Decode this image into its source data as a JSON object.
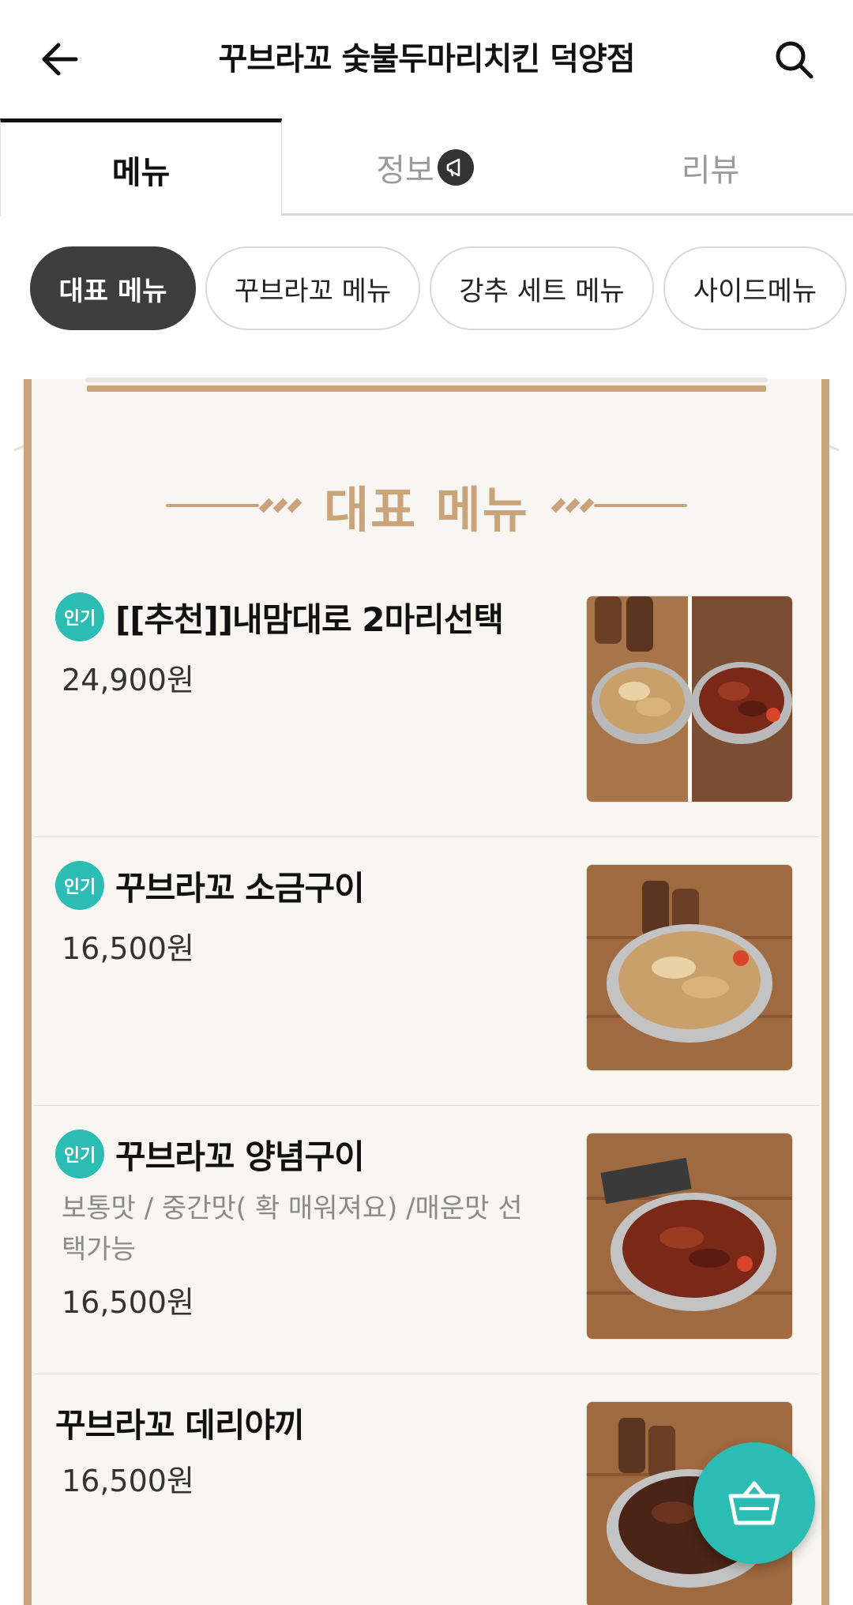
{
  "header": {
    "title": "꾸브라꼬 숯불두마리치킨 덕양점",
    "back_icon": "arrow-left-icon",
    "search_icon": "search-icon"
  },
  "tabs": [
    {
      "label": "메뉴",
      "active": true
    },
    {
      "label": "정보",
      "active": false,
      "badge_icon": "megaphone-icon"
    },
    {
      "label": "리뷰",
      "active": false
    }
  ],
  "categories": [
    {
      "label": "대표 메뉴",
      "active": true
    },
    {
      "label": "꾸브라꼬 메뉴",
      "active": false
    },
    {
      "label": "강추 세트 메뉴",
      "active": false
    },
    {
      "label": "사이드메뉴",
      "active": false
    }
  ],
  "board": {
    "title": "대표 메뉴"
  },
  "items": [
    {
      "name": "[[추천]]내맘대로 2마리선택",
      "badge": "인기",
      "description": "",
      "price": "24,900원"
    },
    {
      "name": "꾸브라꼬 소금구이",
      "badge": "인기",
      "description": "",
      "price": "16,500원"
    },
    {
      "name": "꾸브라꼬 양념구이",
      "badge": "인기",
      "description": "보통맛 / 중간맛( 확 매워져요) /매운맛 선택가능",
      "price": "16,500원"
    },
    {
      "name": "꾸브라꼬 데리야끼",
      "badge": "",
      "description": "",
      "price": "16,500원"
    }
  ],
  "colors": {
    "accent": "#2bbcb3",
    "gold": "#c9a47a",
    "chip_active": "#3d3d3d"
  },
  "cart_icon": "shopping-basket-icon"
}
